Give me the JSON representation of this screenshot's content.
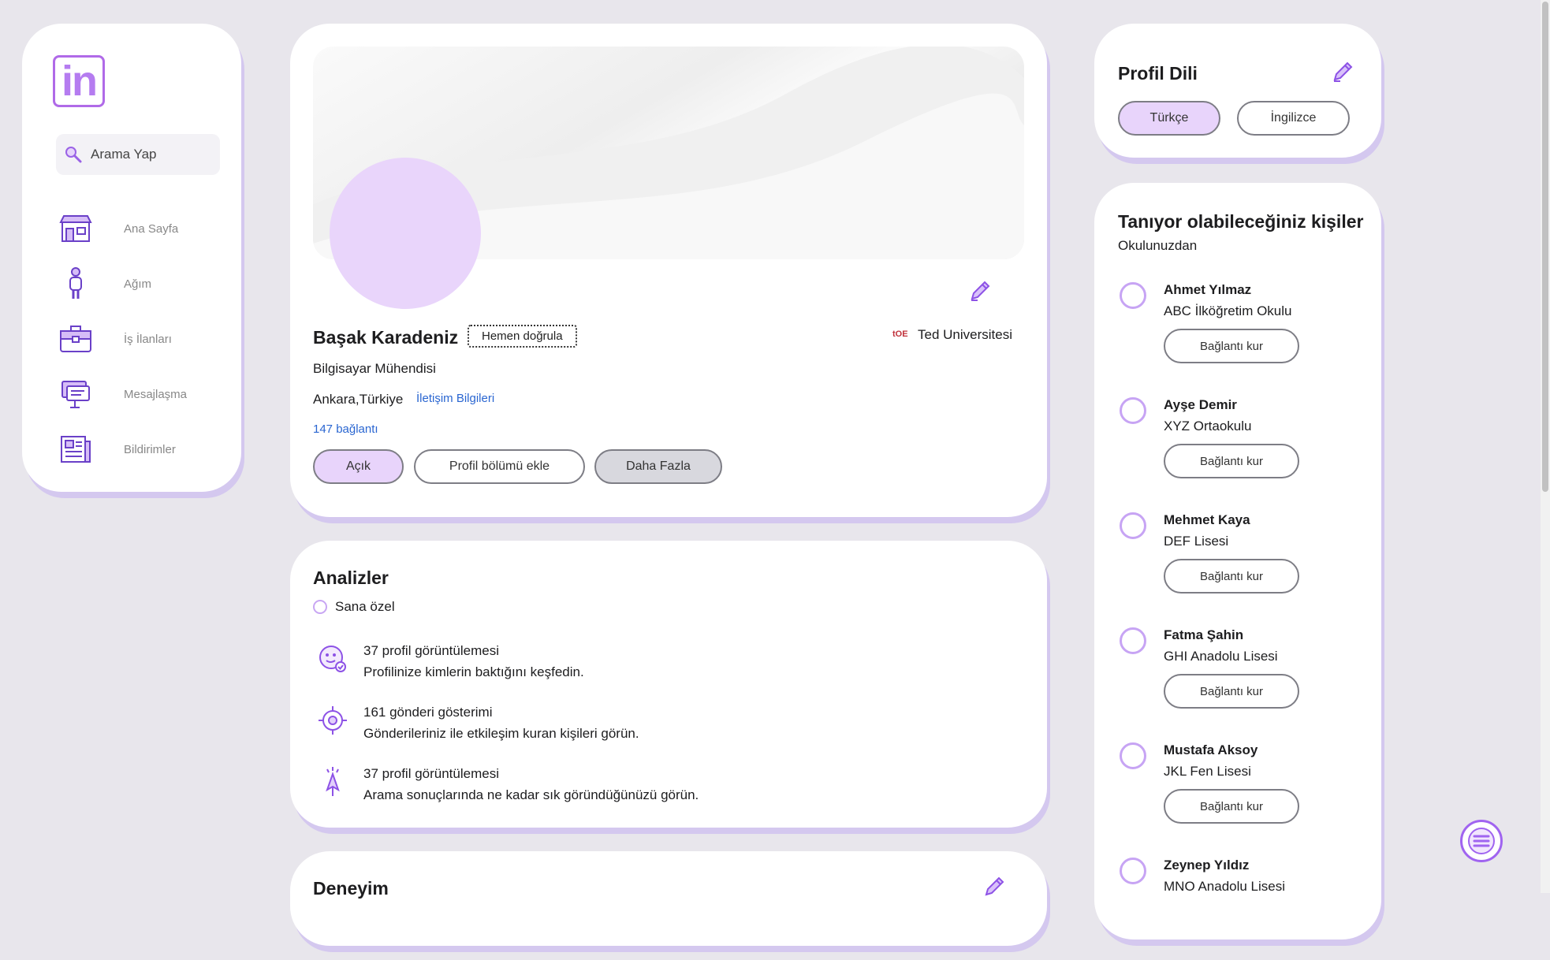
{
  "sidebar": {
    "logo_text": "in",
    "search_placeholder": "Arama Yap",
    "nav": [
      {
        "label": "Ana Sayfa",
        "icon": "home-icon"
      },
      {
        "label": "Ağım",
        "icon": "person-icon"
      },
      {
        "label": "İş İlanları",
        "icon": "briefcase-icon"
      },
      {
        "label": "Mesajlaşma",
        "icon": "chat-icon"
      },
      {
        "label": "Bildirimler",
        "icon": "newspaper-icon"
      }
    ]
  },
  "profile": {
    "name": "Başak Karadeniz",
    "verify_label": "Hemen doğrula",
    "school": "Ted Universitesi",
    "headline": "Bilgisayar Mühendisi",
    "location": "Ankara,Türkiye",
    "contact_link": "İletişim Bilgileri",
    "connections": "147 bağlantı",
    "buttons": {
      "open": "Açık",
      "add_section": "Profil bölümü ekle",
      "more": "Daha Fazla"
    }
  },
  "analytics": {
    "title": "Analizler",
    "private": "Sana özel",
    "rows": [
      {
        "title": "37 profil görüntülemesi",
        "desc": "Profilinize kimlerin baktığını keşfedin.",
        "icon": "profile-views-icon"
      },
      {
        "title": "161 gönderi gösterimi",
        "desc": "Gönderileriniz ile etkileşim kuran kişileri görün.",
        "icon": "post-impressions-icon"
      },
      {
        "title": "37 profil görüntülemesi",
        "desc": "Arama sonuçlarında ne kadar sık göründüğünüzü görün.",
        "icon": "search-appearances-icon"
      }
    ]
  },
  "experience": {
    "title": "Deneyim"
  },
  "language": {
    "title": "Profil Dili",
    "options": [
      "Türkçe",
      "İngilizce"
    ],
    "selected": "Türkçe"
  },
  "people": {
    "title": "Tanıyor olabileceğiniz kişiler",
    "subtitle": "Okulunuzdan",
    "connect_label": "Bağlantı kur",
    "list": [
      {
        "name": "Ahmet Yılmaz",
        "school": "ABC İlköğretim Okulu"
      },
      {
        "name": "Ayşe Demir",
        "school": "XYZ Ortaokulu"
      },
      {
        "name": "Mehmet Kaya",
        "school": "DEF Lisesi"
      },
      {
        "name": "Fatma Şahin",
        "school": "GHI Anadolu Lisesi"
      },
      {
        "name": "Mustafa Aksoy",
        "school": "JKL Fen Lisesi"
      },
      {
        "name": "Zeynep Yıldız",
        "school": "MNO Anadolu Lisesi"
      }
    ]
  },
  "colors": {
    "accent": "#b57cf0",
    "link": "#2a66d1",
    "selected_bg": "#e8d4fb",
    "page_bg": "#e8e6ec"
  }
}
